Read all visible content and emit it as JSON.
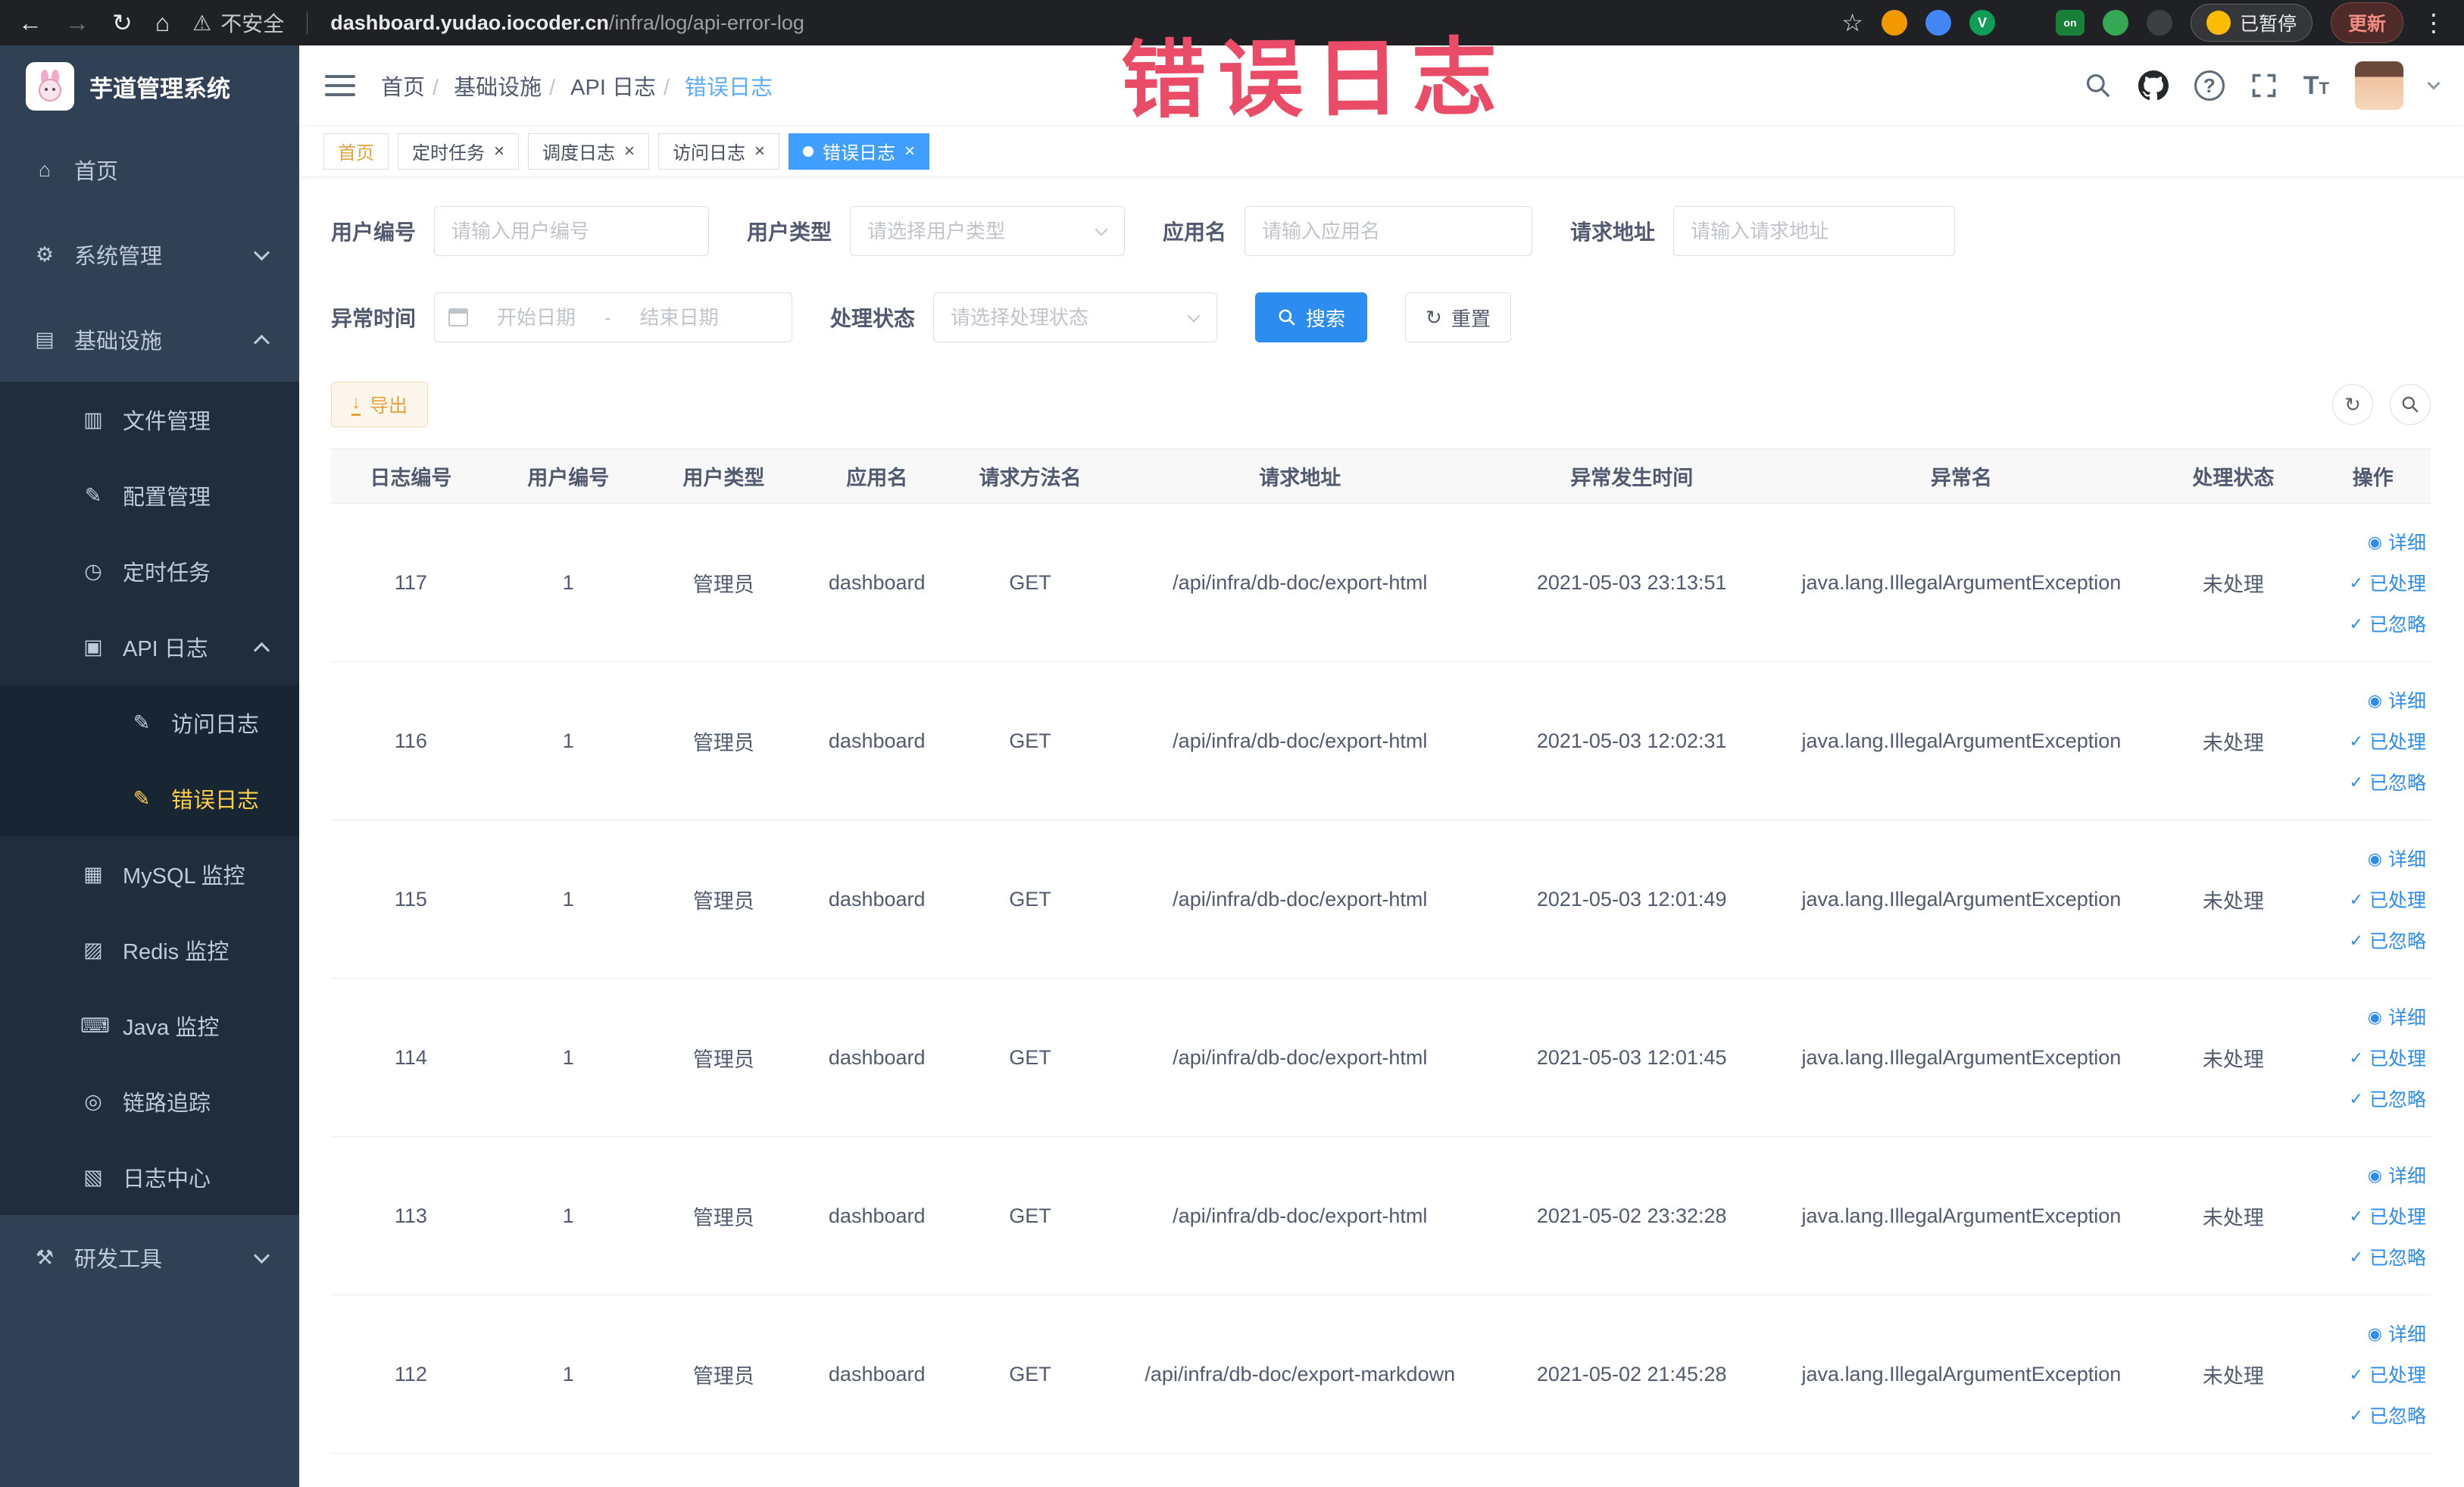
{
  "annotation": {
    "text": "错误日志"
  },
  "browser": {
    "security_label": "不安全",
    "url_domain": "dashboard.yudao.iocoder.cn",
    "url_path": "/infra/log/api-error-log",
    "extension_v_label": "V",
    "extension_on_label": "on",
    "paused_badge": "已暂停",
    "update_button": "更新"
  },
  "sidebar": {
    "logo_title": "芋道管理系统",
    "items": [
      {
        "label": "首页"
      },
      {
        "label": "系统管理"
      },
      {
        "label": "基础设施"
      },
      {
        "label": "文件管理"
      },
      {
        "label": "配置管理"
      },
      {
        "label": "定时任务"
      },
      {
        "label": "API 日志"
      },
      {
        "label": "访问日志"
      },
      {
        "label": "错误日志"
      },
      {
        "label": "MySQL 监控"
      },
      {
        "label": "Redis 监控"
      },
      {
        "label": "Java 监控"
      },
      {
        "label": "链路追踪"
      },
      {
        "label": "日志中心"
      },
      {
        "label": "研发工具"
      }
    ]
  },
  "breadcrumb": [
    "首页",
    "基础设施",
    "API 日志",
    "错误日志"
  ],
  "tags": [
    {
      "label": "首页",
      "active": false,
      "closable": false
    },
    {
      "label": "定时任务",
      "active": false,
      "closable": true
    },
    {
      "label": "调度日志",
      "active": false,
      "closable": true
    },
    {
      "label": "访问日志",
      "active": false,
      "closable": true
    },
    {
      "label": "错误日志",
      "active": true,
      "closable": true
    }
  ],
  "filters": {
    "user_id": {
      "label": "用户编号",
      "placeholder": "请输入用户编号"
    },
    "user_type": {
      "label": "用户类型",
      "placeholder": "请选择用户类型"
    },
    "app_name": {
      "label": "应用名",
      "placeholder": "请输入应用名"
    },
    "request_url": {
      "label": "请求地址",
      "placeholder": "请输入请求地址"
    },
    "exception_time": {
      "label": "异常时间",
      "start_placeholder": "开始日期",
      "separator": "-",
      "end_placeholder": "结束日期"
    },
    "process_status": {
      "label": "处理状态",
      "placeholder": "请选择处理状态"
    },
    "search_button": "搜索",
    "reset_button": "重置"
  },
  "toolbar": {
    "export_button": "导出"
  },
  "table": {
    "columns": [
      "日志编号",
      "用户编号",
      "用户类型",
      "应用名",
      "请求方法名",
      "请求地址",
      "异常发生时间",
      "异常名",
      "处理状态",
      "操作"
    ],
    "actions": {
      "detail": "详细",
      "processed": "已处理",
      "ignored": "已忽略"
    },
    "rows": [
      {
        "id": "117",
        "user_id": "1",
        "user_type": "管理员",
        "app": "dashboard",
        "method": "GET",
        "url": "/api/infra/db-doc/export-html",
        "time": "2021-05-03 23:13:51",
        "exception": "java.lang.IllegalArgumentException",
        "status": "未处理"
      },
      {
        "id": "116",
        "user_id": "1",
        "user_type": "管理员",
        "app": "dashboard",
        "method": "GET",
        "url": "/api/infra/db-doc/export-html",
        "time": "2021-05-03 12:02:31",
        "exception": "java.lang.IllegalArgumentException",
        "status": "未处理"
      },
      {
        "id": "115",
        "user_id": "1",
        "user_type": "管理员",
        "app": "dashboard",
        "method": "GET",
        "url": "/api/infra/db-doc/export-html",
        "time": "2021-05-03 12:01:49",
        "exception": "java.lang.IllegalArgumentException",
        "status": "未处理"
      },
      {
        "id": "114",
        "user_id": "1",
        "user_type": "管理员",
        "app": "dashboard",
        "method": "GET",
        "url": "/api/infra/db-doc/export-html",
        "time": "2021-05-03 12:01:45",
        "exception": "java.lang.IllegalArgumentException",
        "status": "未处理"
      },
      {
        "id": "113",
        "user_id": "1",
        "user_type": "管理员",
        "app": "dashboard",
        "method": "GET",
        "url": "/api/infra/db-doc/export-html",
        "time": "2021-05-02 23:32:28",
        "exception": "java.lang.IllegalArgumentException",
        "status": "未处理"
      },
      {
        "id": "112",
        "user_id": "1",
        "user_type": "管理员",
        "app": "dashboard",
        "method": "GET",
        "url": "/api/infra/db-doc/export-markdown",
        "time": "2021-05-02 21:45:28",
        "exception": "java.lang.IllegalArgumentException",
        "status": "未处理"
      }
    ]
  }
}
